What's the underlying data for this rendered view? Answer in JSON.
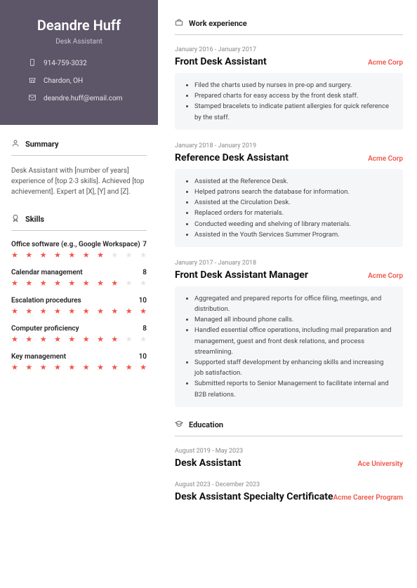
{
  "name": "Deandre Huff",
  "title": "Desk Assistant",
  "contacts": {
    "phone": "914-759-3032",
    "location": "Chardon, OH",
    "email": "deandre.huff@email.com"
  },
  "headings": {
    "summary": "Summary",
    "skills": "Skills",
    "work": "Work experience",
    "education": "Education"
  },
  "summary": "Desk Assistant with [number of years] experience of [top 2-3 skills]. Achieved [top achievement]. Expert at [X], [Y] and [Z].",
  "skills": [
    {
      "name": "Office software (e.g., Google Workspace)",
      "level": 7
    },
    {
      "name": "Calendar management",
      "level": 8
    },
    {
      "name": "Escalation procedures",
      "level": 10
    },
    {
      "name": "Computer proficiency",
      "level": 8
    },
    {
      "name": "Key management",
      "level": 10
    }
  ],
  "work": [
    {
      "dates": "January 2016 - January 2017",
      "title": "Front Desk Assistant",
      "company": "Acme Corp",
      "bullets": [
        "Filed the charts used by nurses in pre-op and surgery.",
        "Prepared charts for easy access by the front desk staff.",
        "Stamped bracelets to indicate patient allergies for quick reference by the staff."
      ]
    },
    {
      "dates": "January 2018 - January 2019",
      "title": "Reference Desk Assistant",
      "company": "Acme Corp",
      "bullets": [
        "Assisted at the Reference Desk.",
        "Helped patrons search the database for information.",
        "Assisted at the Circulation Desk.",
        "Replaced orders for materials.",
        "Conducted weeding and shelving of library materials.",
        "Assisted in the Youth Services Summer Program."
      ]
    },
    {
      "dates": "January 2017 - January 2018",
      "title": "Front Desk Assistant Manager",
      "company": "Acme Corp",
      "bullets": [
        "Aggregated and prepared reports for office filing, meetings, and distribution.",
        "Managed all inbound phone calls.",
        "Handled essential office operations, including mail preparation and management, guest and front desk relations, and process streamlining.",
        "Supported staff development by enhancing skills and increasing job satisfaction.",
        "Submitted reports to Senior Management to facilitate internal and B2B relations."
      ]
    }
  ],
  "education": [
    {
      "dates": "August 2019 - May 2023",
      "title": "Desk Assistant",
      "school": "Ace University"
    },
    {
      "dates": "August 2023 - December 2023",
      "title": "Desk Assistant Specialty Certificate",
      "school": "Acme Career Program"
    }
  ]
}
